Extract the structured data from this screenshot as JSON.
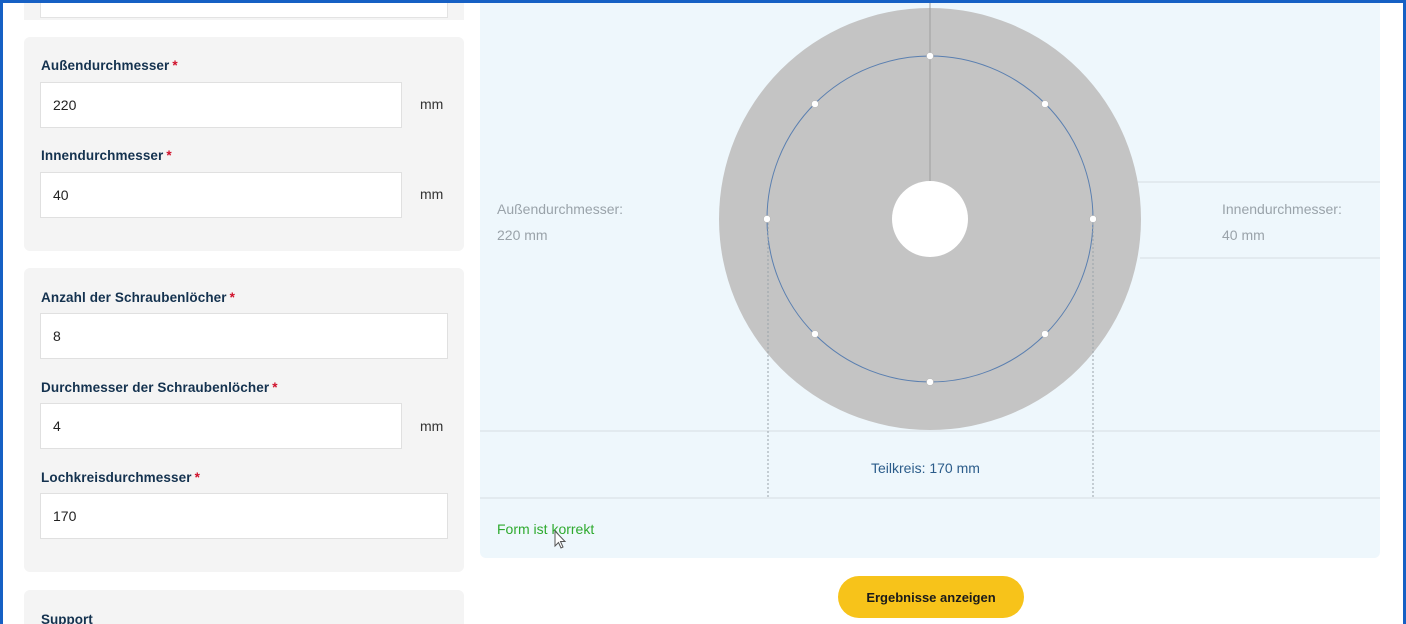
{
  "section_dimensions": {
    "outer_diameter": {
      "label": "Außendurchmesser",
      "required_mark": "*",
      "value": "220",
      "unit": "mm"
    },
    "inner_diameter": {
      "label": "Innendurchmesser",
      "required_mark": "*",
      "value": "40",
      "unit": "mm"
    }
  },
  "section_holes": {
    "hole_count": {
      "label": "Anzahl der Schraubenlöcher",
      "required_mark": "*",
      "value": "8"
    },
    "hole_diameter": {
      "label": "Durchmesser der Schraubenlöcher",
      "required_mark": "*",
      "value": "4",
      "unit": "mm"
    },
    "bolt_circle": {
      "label": "Lochkreisdurchmesser",
      "required_mark": "*",
      "value": "170"
    }
  },
  "drawing": {
    "outer_label_line1": "Außendurchmesser:",
    "outer_label_line2": "220 mm",
    "inner_label_line1": "Innendurchmesser:",
    "inner_label_line2": "40 mm",
    "pitch_circle_label": "Teilkreis: 170 mm",
    "status": "Form ist korrekt",
    "colors": {
      "disc": "#c4c4c4",
      "panel": "#eef7fc",
      "pitch_circle": "#5a7fb0",
      "status": "#2eaa2e"
    }
  },
  "actions": {
    "show_results": "Ergebnisse anzeigen"
  },
  "support": {
    "title": "Support"
  }
}
